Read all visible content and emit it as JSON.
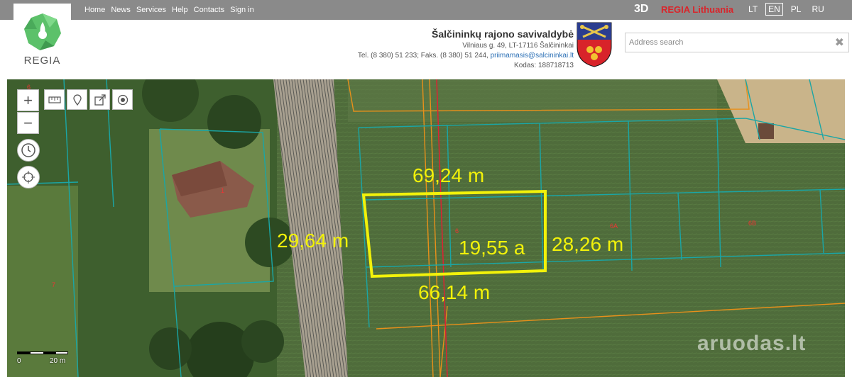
{
  "nav": {
    "items": [
      "Home",
      "News",
      "Services",
      "Help",
      "Contacts",
      "Sign in"
    ],
    "brand_3d": "3D",
    "brand_name": "REGIA Lithuania",
    "languages": [
      "LT",
      "EN",
      "PL",
      "RU"
    ],
    "active_language": "EN"
  },
  "logo": {
    "text": "REGIA"
  },
  "municipality": {
    "name": "Šalčininkų rajono savivaldybė",
    "address": "Vilniaus g. 49, LT-17116 Šalčininkai",
    "phones": "Tel. (8 380) 51 233; Faks. (8 380) 51 244,",
    "email": "priimamasis@salcininkai.lt",
    "code": "Kodas: 188718713"
  },
  "search": {
    "placeholder": "Address search",
    "value": "",
    "clear_icon": "close-icon"
  },
  "map": {
    "measurements": {
      "top": "69,24 m",
      "left": "29,64 m",
      "right": "28,26 m",
      "bottom": "66,14 m",
      "area": "19,55 a"
    },
    "parcel_labels": [
      "6",
      "1",
      "6",
      "6A",
      "6B",
      "7"
    ],
    "scale": {
      "start": "0",
      "end": "20 m"
    },
    "colors": {
      "selection": "#f2f20a",
      "parcel": "#1aa6a6",
      "boundary": "#e8901a",
      "label": "#e33"
    }
  },
  "controls": {
    "zoom_in": "+",
    "zoom_out": "−",
    "tools": [
      "ruler-icon",
      "marker-icon",
      "export-icon",
      "target-icon"
    ]
  },
  "watermark": "aruodas.lt"
}
